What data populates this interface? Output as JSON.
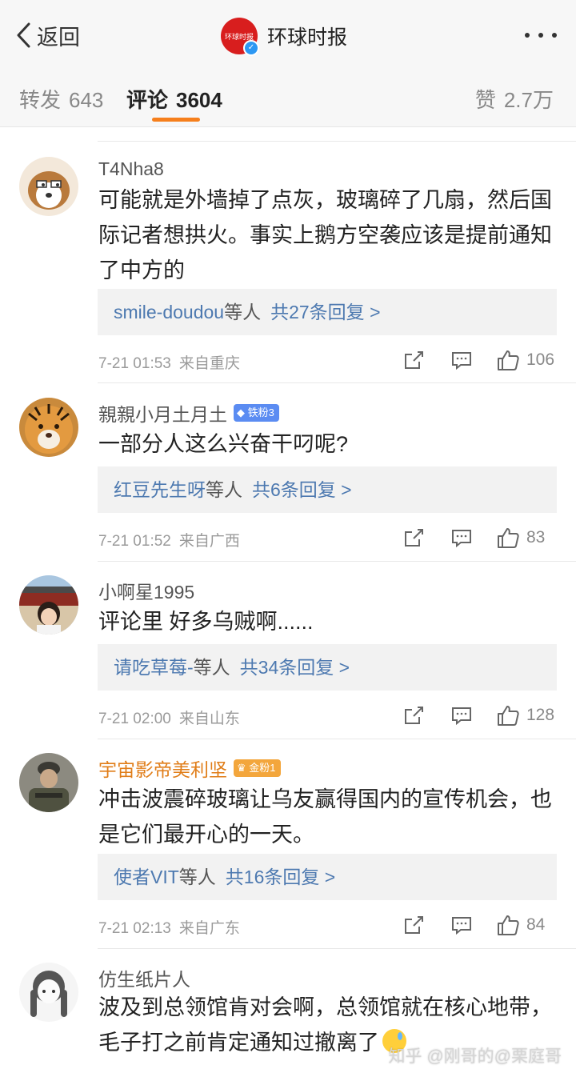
{
  "header": {
    "back_label": "返回",
    "logo_text": "环球时报",
    "title": "环球时报"
  },
  "tabs": {
    "repost_label": "转发",
    "repost_count": "643",
    "comments_label": "评论",
    "comments_count": "3604",
    "likes_label": "赞",
    "likes_count": "2.7万"
  },
  "comments": [
    {
      "user": "T4Nha8",
      "badge": "",
      "text": "可能就是外墙掉了点灰，玻璃碎了几扇，然后国际记者想拱火。事实上鹅方空袭应该是提前通知了中方的",
      "reply_names": "smile-doudou",
      "reply_who": "等人",
      "reply_count": "共27条回复 >",
      "time": "7-21 01:53",
      "source": "来自重庆",
      "likes": "106"
    },
    {
      "user": "親親小月土月土",
      "badge": "铁粉3",
      "text": "一部分人这么兴奋干叼呢?",
      "reply_names": "红豆先生呀",
      "reply_who": "等人",
      "reply_count": "共6条回复 >",
      "time": "7-21 01:52",
      "source": "来自广西",
      "likes": "83"
    },
    {
      "user": "小啊星1995",
      "badge": "",
      "text": "评论里 好多乌贼啊......",
      "reply_names": "请吃草莓-",
      "reply_who": "等人",
      "reply_count": "共34条回复 >",
      "time": "7-21 02:00",
      "source": "来自山东",
      "likes": "128"
    },
    {
      "user": "宇宙影帝美利坚",
      "badge": "金粉1",
      "text": "冲击波震碎玻璃让乌友赢得国内的宣传机会，也是它们最开心的一天。",
      "reply_names": "使者VIT",
      "reply_who": "等人",
      "reply_count": "共16条回复 >",
      "time": "7-21 02:13",
      "source": "来自广东",
      "likes": "84"
    },
    {
      "user": "仿生纸片人",
      "badge": "",
      "text": "波及到总领馆肯对会啊，总领馆就在核心地带，毛子打之前肯定通知过撤离了"
    }
  ],
  "watermark": "知乎 @刚哥的@栗庭哥",
  "colors": {
    "accent": "#f67f1c",
    "link": "#4d79b0",
    "gold_name": "#e07d18",
    "brand_red": "#d81e1e"
  }
}
